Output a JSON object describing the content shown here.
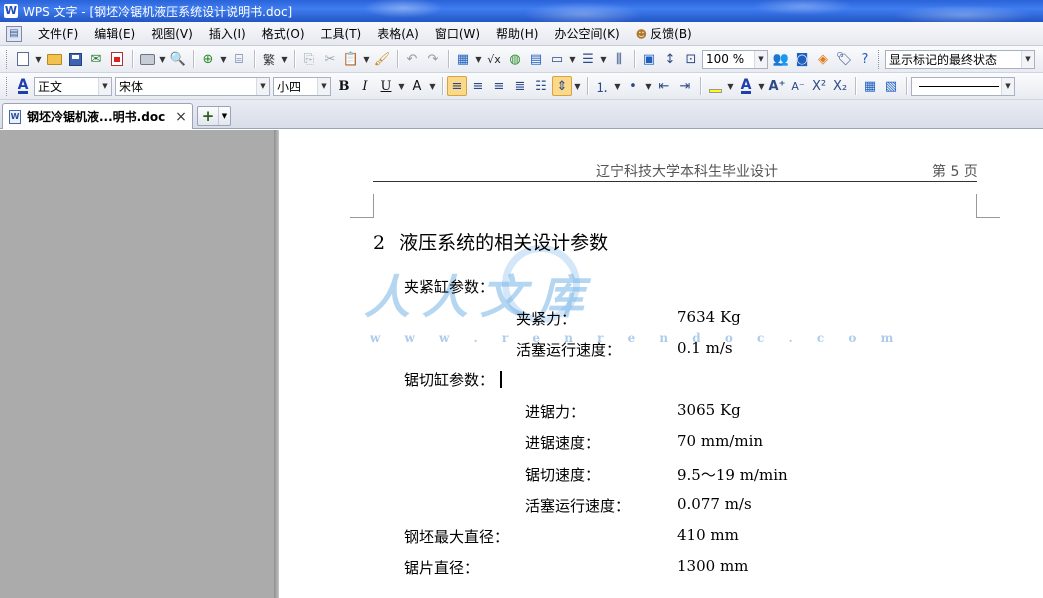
{
  "window": {
    "title": "WPS 文字 - [钢坯冷锯机液压系统设计说明书.doc]",
    "app_icon": "W"
  },
  "menu": {
    "items": [
      "文件(F)",
      "编辑(E)",
      "视图(V)",
      "插入(I)",
      "格式(O)",
      "工具(T)",
      "表格(A)",
      "窗口(W)",
      "帮助(H)",
      "办公空间(K)",
      "反馈(B)"
    ]
  },
  "toolbar": {
    "zoom": "100 %",
    "track_mode": "显示标记的最终状态",
    "style": "正文",
    "font": "宋体",
    "font_size": "小四"
  },
  "tabs": {
    "active_label": "钢坯冷锯机液...明书.doc",
    "close_symbol": "×",
    "new_symbol": "+"
  },
  "document": {
    "header_school": "辽宁科技大学本科生毕业设计",
    "header_page": "第 5 页",
    "heading_num": "2",
    "heading_text": "液压系统的相关设计参数",
    "clamp_title": "夹紧缸参数：",
    "clamp_force_label": "夹紧力：",
    "clamp_force_value": "7634 Kg",
    "clamp_speed_label": "活塞运行速度：",
    "clamp_speed_value": "0.1 m/s",
    "saw_title": "锯切缸参数：",
    "feed_force_label": "进锯力：",
    "feed_force_value": "3065 Kg",
    "feed_speed_label": "进锯速度：",
    "feed_speed_value": "70 mm/min",
    "cut_speed_label": "锯切速度：",
    "cut_speed_value": "9.5～19 m/min",
    "saw_piston_label": "活塞运行速度：",
    "saw_piston_value": "0.077 m/s",
    "billet_label": "钢坯最大直径：",
    "billet_value": "410 mm",
    "blade_label": "锯片直径：",
    "blade_value": "1300 mm"
  },
  "watermark": {
    "text": "人人文库",
    "url": "w w w . r e n r e n d o c . c o m"
  }
}
